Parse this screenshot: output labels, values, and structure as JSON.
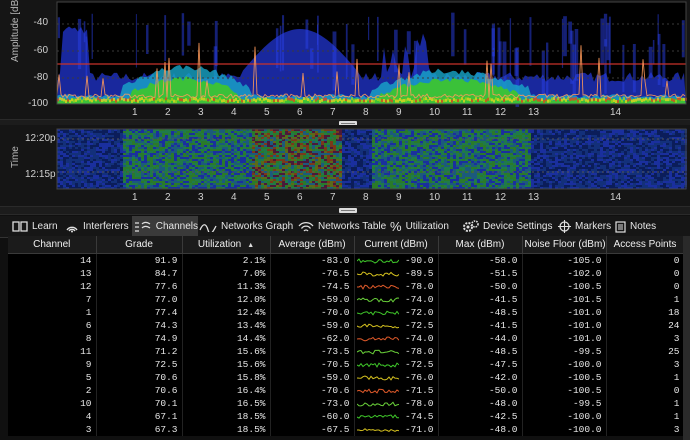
{
  "spectrum": {
    "y_axis_label": "Amplitude [dBm]",
    "y_ticks": [
      "-40",
      "-60",
      "-80",
      "-100"
    ],
    "x_ticks": [
      "1",
      "2",
      "3",
      "4",
      "5",
      "6",
      "7",
      "8",
      "9",
      "10",
      "11",
      "12",
      "13",
      "14"
    ]
  },
  "waterfall": {
    "y_axis_label": "Time",
    "y_ticks": [
      "12:20p",
      "12:15p"
    ],
    "x_ticks": [
      "1",
      "2",
      "3",
      "4",
      "5",
      "6",
      "7",
      "8",
      "9",
      "10",
      "11",
      "12",
      "13",
      "14"
    ]
  },
  "tabs": [
    {
      "label": "Learn",
      "icon": "book-icon",
      "active": false
    },
    {
      "label": "Interferers",
      "icon": "interferers-icon",
      "active": false
    },
    {
      "label": "Channels",
      "icon": "channels-icon",
      "active": true
    },
    {
      "label": "Networks Graph",
      "icon": "networks-graph-icon",
      "active": false
    },
    {
      "label": "Networks Table",
      "icon": "wifi-icon",
      "active": false
    },
    {
      "label": "Utilization",
      "icon": "percent-icon",
      "active": false
    },
    {
      "label": "Device Settings",
      "icon": "gears-icon",
      "active": false
    },
    {
      "label": "Markers",
      "icon": "crosshair-icon",
      "active": false
    },
    {
      "label": "Notes",
      "icon": "notes-icon",
      "active": false
    }
  ],
  "table": {
    "headers": [
      "Channel",
      "Grade",
      "Utilization",
      "Average (dBm)",
      "Current (dBm)",
      "Max (dBm)",
      "Noise Floor (dBm)",
      "Access Points"
    ],
    "sort_column": "Utilization",
    "rows": [
      [
        "14",
        "91.9",
        "2.1%",
        "-83.0",
        "-90.0",
        "-58.0",
        "-105.0",
        "0"
      ],
      [
        "13",
        "84.7",
        "7.0%",
        "-76.5",
        "-89.5",
        "-51.5",
        "-102.0",
        "0"
      ],
      [
        "12",
        "77.6",
        "11.3%",
        "-74.5",
        "-78.0",
        "-50.0",
        "-100.5",
        "0"
      ],
      [
        "7",
        "77.0",
        "12.0%",
        "-59.0",
        "-74.0",
        "-41.5",
        "-101.5",
        "1"
      ],
      [
        "1",
        "77.4",
        "12.4%",
        "-70.0",
        "-72.0",
        "-48.5",
        "-101.0",
        "18"
      ],
      [
        "6",
        "74.3",
        "13.4%",
        "-59.0",
        "-72.5",
        "-41.5",
        "-101.0",
        "24"
      ],
      [
        "8",
        "74.9",
        "14.4%",
        "-62.0",
        "-74.0",
        "-44.0",
        "-101.0",
        "3"
      ],
      [
        "11",
        "71.2",
        "15.6%",
        "-73.5",
        "-78.0",
        "-48.5",
        "-99.5",
        "25"
      ],
      [
        "9",
        "72.5",
        "15.6%",
        "-70.5",
        "-72.5",
        "-47.5",
        "-100.0",
        "3"
      ],
      [
        "5",
        "70.6",
        "15.8%",
        "-59.0",
        "-76.0",
        "-42.0",
        "-100.5",
        "1"
      ],
      [
        "2",
        "70.6",
        "16.4%",
        "-70.6",
        "-71.5",
        "-50.0",
        "-100.5",
        "0"
      ],
      [
        "10",
        "70.1",
        "16.5%",
        "-73.0",
        "-78.0",
        "-48.0",
        "-99.5",
        "1"
      ],
      [
        "4",
        "67.1",
        "18.5%",
        "-60.0",
        "-74.5",
        "-42.5",
        "-100.0",
        "1"
      ],
      [
        "3",
        "67.3",
        "18.5%",
        "-67.5",
        "-71.0",
        "-48.0",
        "-100.0",
        "3"
      ]
    ]
  },
  "colors": {
    "background": "#101010",
    "threshold_line": "#c8322a",
    "trace_peak": "#ff9a5a",
    "spectrum_blue": "#1a2fd6",
    "spectrum_green": "#39c12d"
  }
}
